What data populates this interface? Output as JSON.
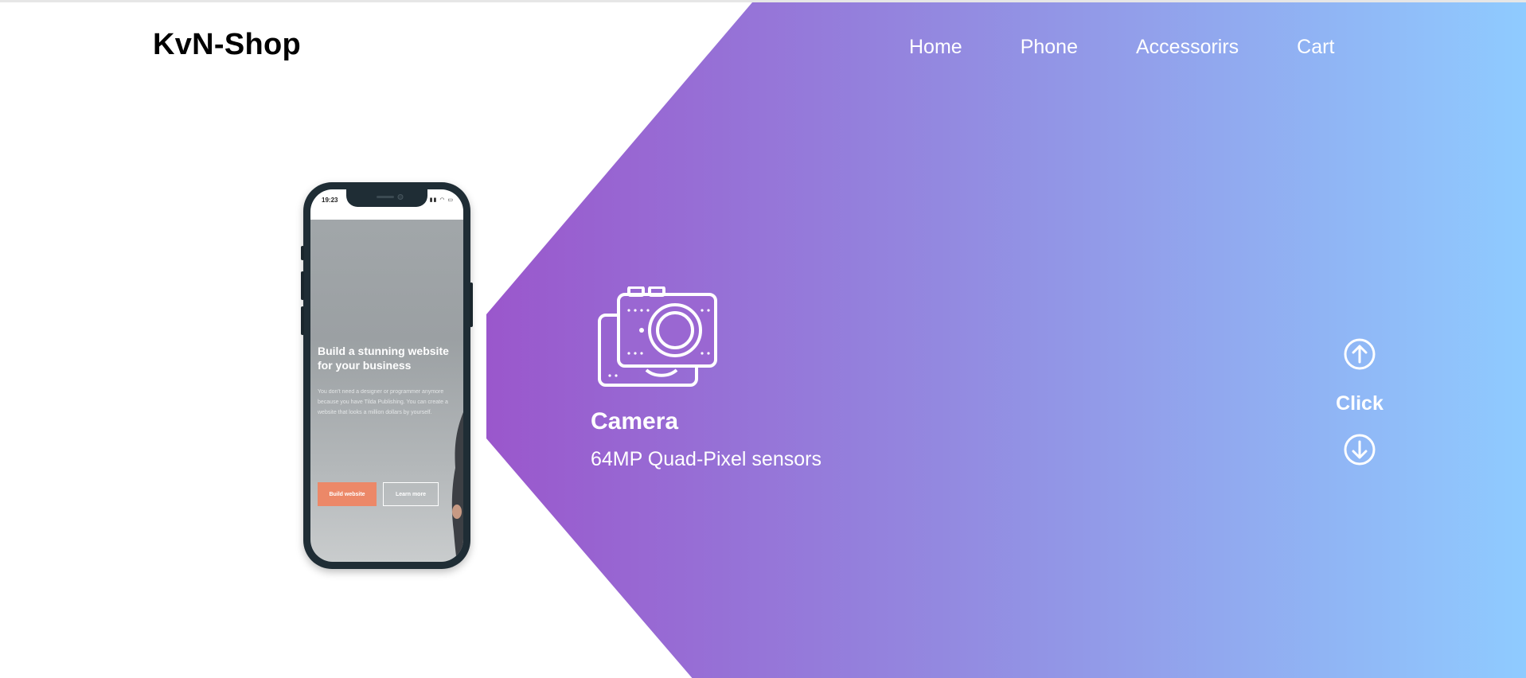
{
  "brand": {
    "logo": "KvN-Shop"
  },
  "nav": {
    "items": [
      {
        "label": "Home"
      },
      {
        "label": "Phone"
      },
      {
        "label": "Accessorirs"
      },
      {
        "label": "Cart"
      }
    ]
  },
  "phone_screen": {
    "time": "19:23",
    "heading": "Build a stunning website for your business",
    "body": "You don't need a designer or programmer anymore because you have Tilda Publishing. You can create a website that looks a million dollars by yourself.",
    "primary_button": "Build website",
    "secondary_button": "Learn more"
  },
  "feature": {
    "icon": "camera-icon",
    "title": "Camera",
    "description": "64MP Quad-Pixel sensors"
  },
  "control": {
    "label": "Click",
    "up_icon": "arrow-up-circle-icon",
    "down_icon": "arrow-down-circle-icon"
  },
  "colors": {
    "gradient_start": "#9a57cc",
    "gradient_mid": "#9389e0",
    "gradient_end": "#8fcbff",
    "accent_button": "#ec8868"
  }
}
